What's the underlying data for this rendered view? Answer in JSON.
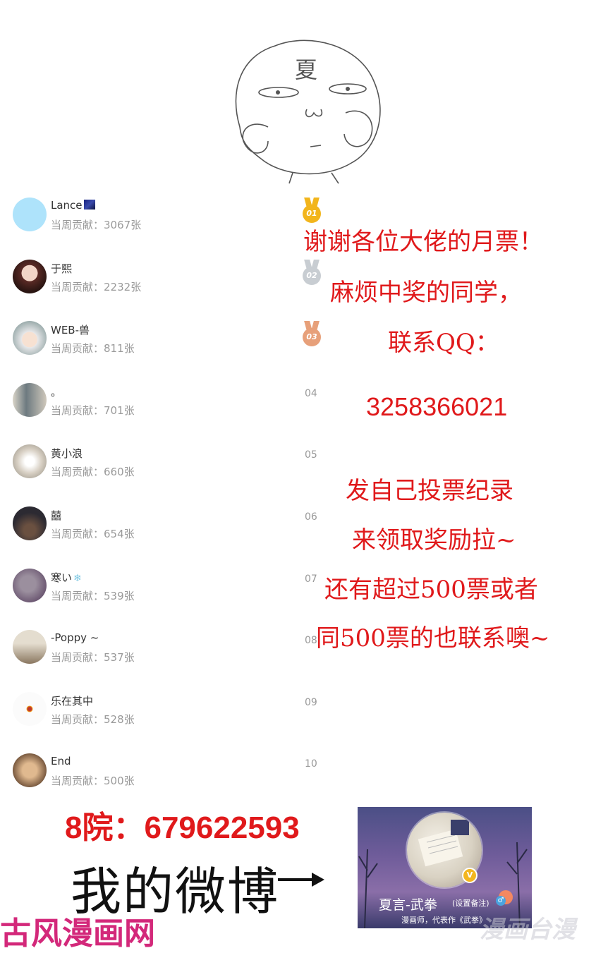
{
  "sketch": {
    "face_text": "夏"
  },
  "leaderboard": {
    "contrib_prefix": "当周贡献：",
    "entries": [
      {
        "name": "Lance",
        "contribution": "3067张",
        "rank": "01"
      },
      {
        "name": "于熙",
        "contribution": "2232张",
        "rank": "02"
      },
      {
        "name": "WEB-兽",
        "contribution": "811张",
        "rank": "03"
      },
      {
        "name": "。",
        "contribution": "701张",
        "rank": "04"
      },
      {
        "name": "黄小浪",
        "contribution": "660张",
        "rank": "05"
      },
      {
        "name": "囍",
        "contribution": "654张",
        "rank": "06"
      },
      {
        "name": "寒い",
        "contribution": "539张",
        "rank": "07"
      },
      {
        "name": "-Poppy ~",
        "contribution": "537张",
        "rank": "08"
      },
      {
        "name": "乐在其中",
        "contribution": "528张",
        "rank": "09"
      },
      {
        "name": "End",
        "contribution": "500张",
        "rank": "10"
      }
    ]
  },
  "message": {
    "line1": "谢谢各位大佬的月票！",
    "line2": "麻烦中奖的同学，",
    "line3": "联系QQ：",
    "line4": "3258366021",
    "line5": "发自己投票纪录",
    "line6": "来领取奖励拉~",
    "line7": "还有超过500票或者",
    "line8": "同500票的也联系噢~"
  },
  "footer": {
    "qq_group": "8院：679622593",
    "weibo_label": "我的微博"
  },
  "weibo_card": {
    "name": "夏言-武拳",
    "note": "(设置备注)",
    "description": "漫画师，代表作《武拳》",
    "verified_badge": "V"
  },
  "branding": {
    "site_logo": "古风漫画网",
    "watermark": "漫画台漫"
  },
  "colors": {
    "accent_red": "#e0191b",
    "gold": "#f2b51c",
    "silver": "#c8cdd2",
    "bronze": "#e7a07a"
  }
}
